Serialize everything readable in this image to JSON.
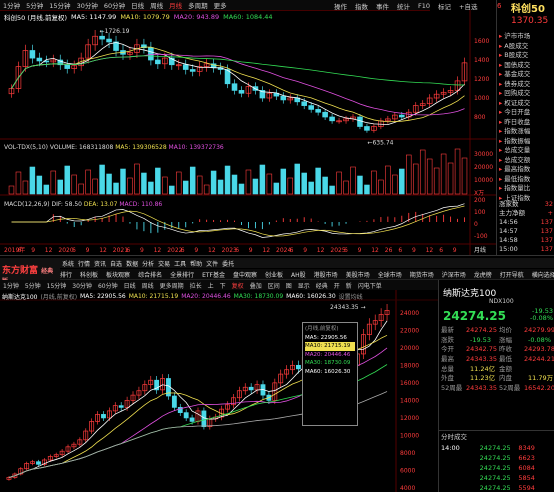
{
  "top_window": {
    "tabs": [
      "1分钟",
      "5分钟",
      "15分钟",
      "30分钟",
      "60分钟",
      "日线",
      "周线",
      "月线",
      "多周期",
      "更多"
    ],
    "active_tab": "月线",
    "right_menu": [
      "操作",
      "指数",
      "事件",
      "统计",
      "F10",
      "标记",
      "+自选"
    ],
    "legend": {
      "name": "科创50 (月线,前复权)",
      "ma5": "MA5: 1147.99",
      "ma10": "MA10: 1079.79",
      "ma20": "MA20: 943.89",
      "ma60": "MA60: 1084.44"
    },
    "high_label": "1726.19",
    "low_label": "635.74",
    "vol_legend": {
      "name": "VOL-TDX(5,10)",
      "volume": "VOLUME: 168311808",
      "ma5": "MA5: 139306528",
      "ma10": "MA10: 139372736"
    },
    "macd_legend": {
      "name": "MACD(12,26,9)",
      "dif": "DIF: 58.50",
      "dea": "DEA: 13.07",
      "macd": "MACD: 110.86"
    },
    "time_axis": [
      "2019年",
      "6",
      "9",
      "12",
      "2020",
      "6",
      "9",
      "12",
      "2021",
      "6",
      "9",
      "12",
      "2022",
      "6",
      "9",
      "12",
      "2023",
      "6",
      "9",
      "12",
      "2024",
      "6",
      "9",
      "12",
      "2025",
      "6",
      "9",
      "12",
      "26",
      "6",
      "9",
      "12",
      "6",
      "9"
    ],
    "y_axis_price": [
      "1600",
      "1400",
      "1200",
      "1000",
      "800"
    ],
    "y_axis_vol": [
      "30000",
      "20000",
      "10000",
      "X万"
    ],
    "y_axis_macd": [
      "200",
      "100",
      "0",
      "-100"
    ],
    "right_label": "月线",
    "side": {
      "num": "6",
      "title": "科创50",
      "price": "1370.35",
      "list": [
        "沪市市场",
        "A股成交",
        "B股成交",
        "国债成交",
        "基金成交",
        "债券成交",
        "回购成交",
        "权证成交",
        "今日开盘",
        "昨日收盘",
        "指数涨幅",
        "指数振幅",
        "总成交量",
        "总成交额",
        "最高指数",
        "最低指数",
        "指数量比",
        "上证指数"
      ],
      "sub": "涨家数",
      "sub2": "主力净额",
      "trades": [
        [
          "14:56",
          "137"
        ],
        [
          "14:57",
          "137"
        ],
        [
          "14:58",
          "137"
        ],
        [
          "15:00",
          "137"
        ]
      ],
      "sub_val": "32",
      "sub2_val": "+"
    }
  },
  "bottom_window": {
    "logo": "东方财富",
    "logo_sub": "经典版",
    "topbar": [
      "系统",
      "行情",
      "资讯",
      "自选",
      "数据",
      "分析",
      "交易",
      "工具",
      "帮助",
      "文件",
      "委托"
    ],
    "menubar": [
      "自选股",
      "沪深京排行",
      "科创板",
      "板块观察",
      "综合排名",
      "全景排行",
      "ETF基金",
      "盘中观察",
      "创业板",
      "AH股",
      "港股市场",
      "美股市场",
      "全球市场",
      "期货市场",
      "沪深市场",
      "龙虎榜",
      "打开导航",
      "横向选择"
    ],
    "tabs": [
      "1分钟",
      "5分钟",
      "15分钟",
      "30分钟",
      "60分钟",
      "日线",
      "周线",
      "更多周期",
      "拉长",
      "上",
      "下",
      "复权",
      "叠加",
      "区间",
      "图",
      "显示",
      "经典",
      "开",
      "新",
      "闪电下单"
    ],
    "active_tab": "复权",
    "legend": {
      "name": "纳斯达克100",
      "mode": "(月线,前复权)",
      "ma5": "MA5: 22905.56",
      "ma10": "MA10: 21715.19",
      "ma20": "MA20: 20446.46",
      "ma30": "MA30: 18730.09",
      "ma60": "MA60: 16026.30",
      "hint": "设置均线"
    },
    "high_label": "24343.35",
    "y_axis": [
      "24000",
      "22000",
      "20000",
      "18000",
      "16000",
      "14000",
      "12000",
      "10000",
      "8000",
      "6000",
      "4000"
    ],
    "tooltip": {
      "title": "(月线,前复权)",
      "rows": [
        "MA5: 22905.56",
        "MA10: 21715.19",
        "MA20: 20446.46",
        "MA30: 18730.09",
        "MA60: 16026.30"
      ]
    },
    "right": {
      "name": "纳斯达克100",
      "code": "NDX100",
      "price": "24274.25",
      "chg": "-19.53",
      "pct": "-0.08%",
      "stats": [
        [
          "最新",
          "24274.25",
          "均价",
          "24279.99"
        ],
        [
          "涨跌",
          "-19.53",
          "涨幅",
          "-0.08%"
        ],
        [
          "今开",
          "24342.75",
          "昨收",
          "24293.78"
        ],
        [
          "最高",
          "24343.35",
          "最低",
          "24244.21"
        ],
        [
          "总量",
          "11.24亿",
          "金额",
          ""
        ],
        [
          "外盘",
          "11.23亿",
          "内盘",
          "11.79万"
        ],
        [
          "52周最",
          "24343.35",
          "52周最",
          "16542.20"
        ]
      ],
      "section": "分时成交",
      "trades": [
        [
          "14:00",
          "24274.25",
          "8349"
        ],
        [
          "",
          "24274.25",
          "6623"
        ],
        [
          "",
          "24274.25",
          "6084"
        ],
        [
          "",
          "24274.25",
          "5854"
        ],
        [
          "",
          "24274.25",
          "5594"
        ],
        [
          "",
          "24274.25",
          "5016"
        ],
        [
          "",
          "24274.25",
          "4862"
        ]
      ]
    }
  },
  "chart_data": [
    {
      "type": "candlestick",
      "title": "科创50 (月线,前复权)",
      "indicators": {
        "MA5": 1147.99,
        "MA10": 1079.79,
        "MA20": 943.89,
        "MA60": 1084.44
      },
      "high": 1726.19,
      "low": 635.74,
      "last": 1370.35,
      "ylim": [
        600,
        1800
      ],
      "close": [
        1100,
        1330,
        1500,
        1420,
        1390,
        1380,
        1400,
        1350,
        1310,
        1340,
        1420,
        1560,
        1650,
        1620,
        1590,
        1500,
        1460,
        1480,
        1560,
        1530,
        1400,
        1360,
        1420,
        1350,
        1350,
        1300,
        1280,
        1330,
        1360,
        1320,
        1300,
        1150,
        1080,
        1050,
        1120,
        1080,
        1000,
        1050,
        1020,
        980,
        1000,
        960,
        920,
        880,
        850,
        800,
        760,
        760,
        780,
        800,
        700,
        660,
        700,
        760,
        780,
        820,
        800,
        850,
        920,
        940,
        1000,
        1040,
        1060,
        1080,
        1180,
        1370
      ]
    },
    {
      "type": "bar",
      "title": "VOL-TDX(5,10)",
      "volume": 168311808,
      "MA5": 139306528,
      "MA10": 139372736
    },
    {
      "type": "bar",
      "title": "MACD(12,26,9)",
      "DIF": 58.5,
      "DEA": 13.07,
      "MACD": 110.86
    },
    {
      "type": "candlestick",
      "title": "纳斯达克100 (月线,前复权)",
      "indicators": {
        "MA5": 22905.56,
        "MA10": 21715.19,
        "MA20": 20446.46,
        "MA30": 18730.09,
        "MA60": 16026.3
      },
      "high": 24343.35,
      "last": 24274.25,
      "ylim": [
        4000,
        25000
      ],
      "close": [
        5200,
        5600,
        6200,
        6800,
        7000,
        6700,
        7200,
        7600,
        7800,
        8200,
        8700,
        9000,
        9500,
        10500,
        11600,
        12400,
        12000,
        12800,
        13400,
        13200,
        14000,
        14600,
        15100,
        15800,
        16300,
        15200,
        16500,
        14500,
        13200,
        12600,
        12000,
        11600,
        12800,
        11000,
        11900,
        12100,
        13000,
        13500,
        14300,
        15100,
        15500,
        15200,
        15800,
        14600,
        14000,
        16000,
        17000,
        17500,
        18000,
        17600,
        18900,
        19500,
        20100,
        19800,
        21000,
        21300,
        20800,
        19500,
        18000,
        19300,
        21500,
        22700,
        23100,
        23800,
        24274
      ]
    }
  ]
}
